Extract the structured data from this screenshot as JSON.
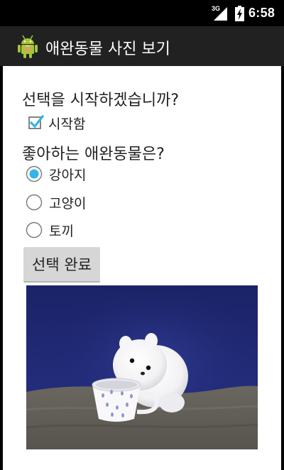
{
  "status_bar": {
    "network": "3G",
    "time": "6:58",
    "signal_icon": "signal-icon",
    "battery_icon": "battery-charging-icon"
  },
  "action_bar": {
    "title": "애완동물 사진 보기",
    "icon": "android-robot-icon"
  },
  "form": {
    "question_start": "선택을 시작하겠습니까?",
    "start_checkbox": {
      "label": "시작함",
      "checked": true
    },
    "question_pet": "좋아하는 애완동물은?",
    "pets": [
      {
        "label": "강아지",
        "selected": true
      },
      {
        "label": "고양이",
        "selected": false
      },
      {
        "label": "토끼",
        "selected": false
      }
    ],
    "submit_label": "선택 완료"
  },
  "image": {
    "subject": "white puppy beside a teacup",
    "icon": "puppy-photo"
  },
  "colors": {
    "action_bar": "#212121",
    "accent": "#33b5e5",
    "background": "#ffffff",
    "android_green": "#a4c639"
  }
}
